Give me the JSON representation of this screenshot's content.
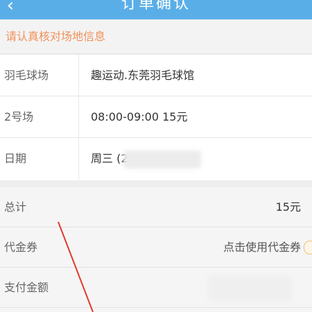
{
  "header": {
    "back_icon": "chevron-left-icon",
    "title": "订单确认"
  },
  "notice": {
    "text": "请认真核对场地信息"
  },
  "info": {
    "rows": [
      {
        "label": "羽毛球场",
        "value": "趣运动.东莞羽毛球馆"
      },
      {
        "label": "2号场",
        "value": "08:00-09:00 15元"
      },
      {
        "label": "日期",
        "value": "周三 (2"
      }
    ]
  },
  "summary": {
    "rows": [
      {
        "label": "总计",
        "value": "15元"
      },
      {
        "label": "代金券",
        "value": "点击使用代金券"
      },
      {
        "label": "支付金额",
        "value": ""
      }
    ]
  },
  "colors": {
    "header_bg": "#5aaee8",
    "notice_text": "#f0915a",
    "annotation_line": "#e0392b"
  }
}
